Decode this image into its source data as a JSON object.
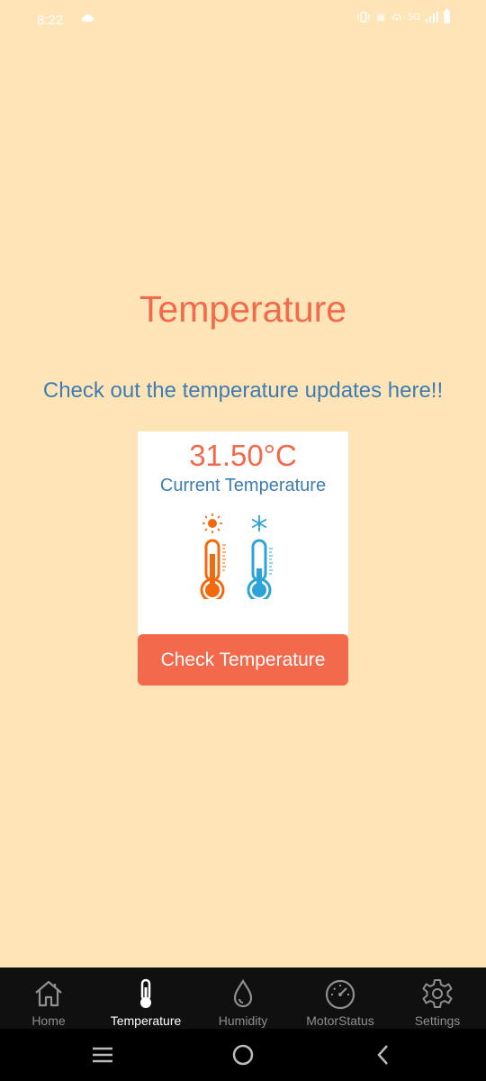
{
  "status": {
    "time": "8:22",
    "network": "5G"
  },
  "page": {
    "title": "Temperature",
    "subtitle": "Check out the temperature updates here!!"
  },
  "card": {
    "value": "31.50°C",
    "label": "Current Temperature",
    "hot_icon": "thermometer-hot-icon",
    "cold_icon": "thermometer-cold-icon"
  },
  "button": {
    "label": "Check Temperature"
  },
  "tabs": [
    {
      "label": "Home",
      "icon": "home-icon",
      "active": false
    },
    {
      "label": "Temperature",
      "icon": "thermometer-icon",
      "active": true
    },
    {
      "label": "Humidity",
      "icon": "droplet-icon",
      "active": false
    },
    {
      "label": "MotorStatus",
      "icon": "speedometer-icon",
      "active": false
    },
    {
      "label": "Settings",
      "icon": "gear-icon",
      "active": false
    }
  ],
  "colors": {
    "background": "#FFE4B7",
    "accent": "#F26A4B",
    "blue": "#3E7CB1",
    "tab_bar": "#101010"
  }
}
